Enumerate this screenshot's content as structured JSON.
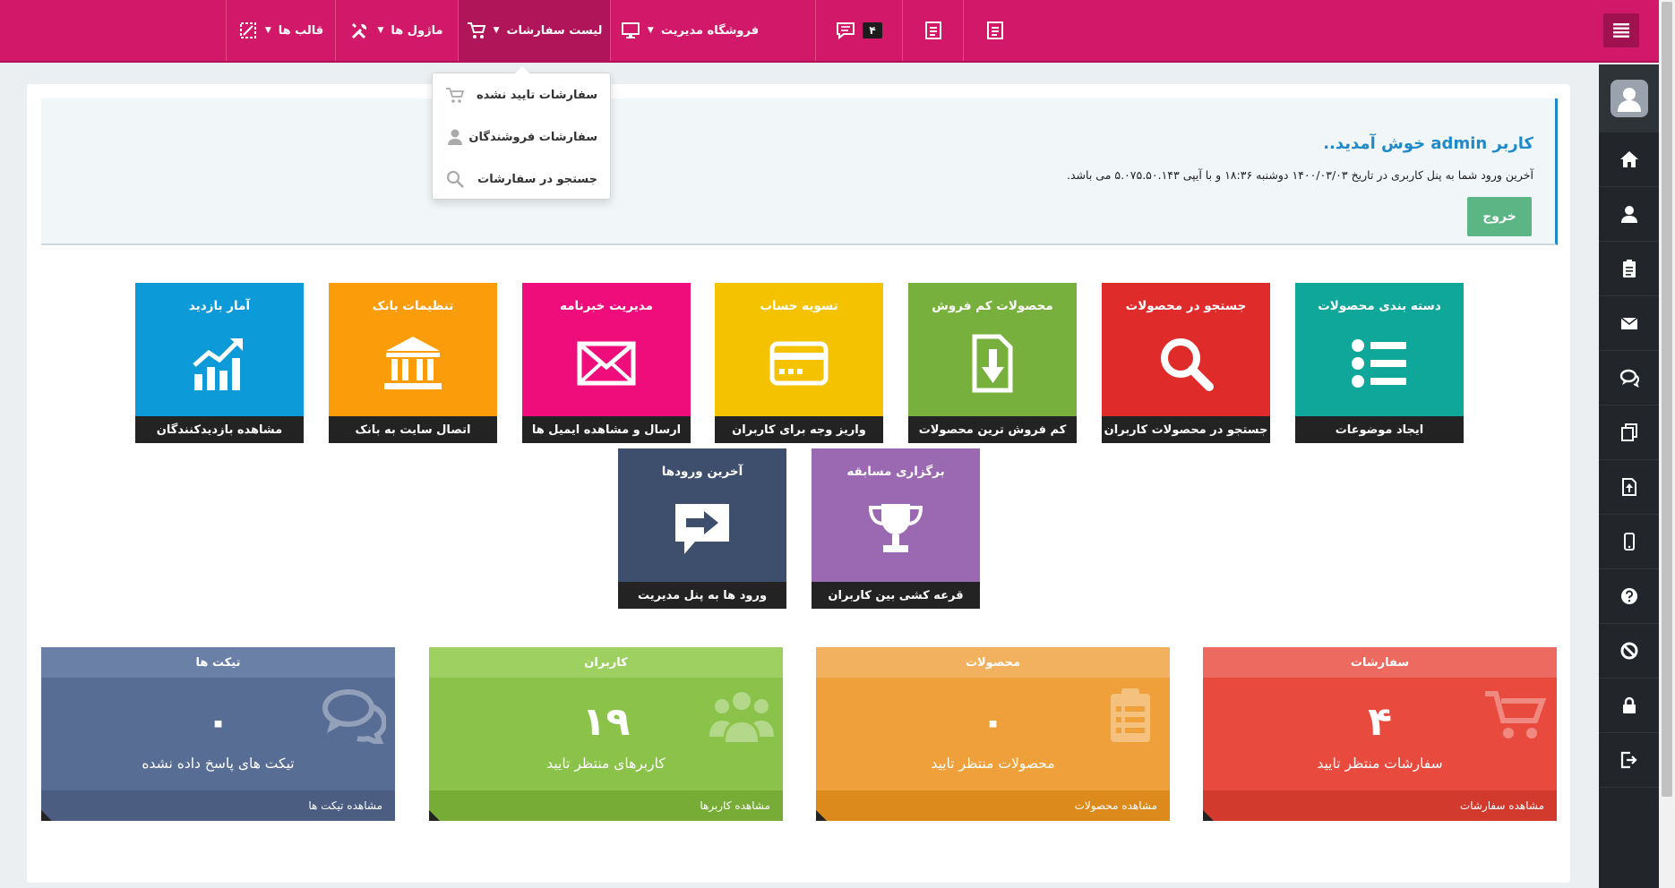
{
  "topbar": {
    "nav": [
      {
        "label": "فروشگاه مدیریت",
        "icon": "monitor-icon"
      },
      {
        "label": "لیست سفارشات",
        "icon": "cart-icon",
        "active": true
      },
      {
        "label": "ماژول ها",
        "icon": "tools-icon"
      },
      {
        "label": "قالب ها",
        "icon": "template-icon"
      }
    ],
    "message_count": "۴"
  },
  "dropdown": {
    "items": [
      {
        "label": "سفارشات تایید نشده",
        "icon": "cart-outline-icon"
      },
      {
        "label": "سفارشات فروشندگان",
        "icon": "user-icon"
      },
      {
        "label": "جستجو در سفارشات",
        "icon": "search-icon"
      }
    ]
  },
  "welcome": {
    "title": "کاربر admin خوش آمدید..",
    "text": "آخرین ورود شما به پنل کاربری در تاریخ ۱۴۰۰/۰۳/۰۳ دوشنبه ۱۸:۳۶ و با آیپی ۵.۰۷۵.۵۰.۱۴۳ می باشد.",
    "logout": "خروج"
  },
  "tiles": [
    {
      "title": "دسته بندی محصولات",
      "footer": "ایجاد موضوعات",
      "color": "#0fa79a",
      "icon": "list-icon"
    },
    {
      "title": "جستجو در محصولات",
      "footer": "جستجو در محصولات کاربران",
      "color": "#e02b2b",
      "icon": "search-icon"
    },
    {
      "title": "محصولات کم فروش",
      "footer": "کم فروش ترین محصولات",
      "color": "#77b03c",
      "icon": "download-doc-icon"
    },
    {
      "title": "تسویه حساب",
      "footer": "واریز وجه برای کاربران",
      "color": "#f5c200",
      "icon": "credit-card-icon"
    },
    {
      "title": "مدیریت خبرنامه",
      "footer": "ارسال و مشاهده ایمیل ها",
      "color": "#ee0d7b",
      "icon": "envelope-icon"
    },
    {
      "title": "تنظیمات بانک",
      "footer": "اتصال سایت به بانک",
      "color": "#fb9c0a",
      "icon": "bank-icon"
    },
    {
      "title": "آمار بازدید",
      "footer": "مشاهده بازدیدکنندگان",
      "color": "#0c9ad8",
      "icon": "chart-up-icon"
    },
    {
      "title": "برگزاری مسابقه",
      "footer": "قرعه کشی بین کاربران",
      "color": "#9b69b2",
      "icon": "trophy-icon"
    },
    {
      "title": "آخرین ورودها",
      "footer": "ورود ها به پنل مدیریت",
      "color": "#3e4f6e",
      "icon": "arrow-bubble-icon"
    }
  ],
  "stats": [
    {
      "title": "سفارشات",
      "value": "۴",
      "label": "سفارشات منتظر تایید",
      "footer": "مشاهده سفارشات",
      "color": "#e84b3e",
      "head": "#ec6a5f",
      "foot": "#d23a2e",
      "icon": "cart-icon"
    },
    {
      "title": "محصولات",
      "value": "۰",
      "label": "محصولات منتظر تایید",
      "footer": "مشاهده محصولات",
      "color": "#f0a03a",
      "head": "#f2b15e",
      "foot": "#dc8a1c",
      "icon": "clipboard-icon"
    },
    {
      "title": "کاربران",
      "value": "۱۹",
      "label": "کاربرهای منتظر تایید",
      "footer": "مشاهده کاربرها",
      "color": "#8bc34a",
      "head": "#9dd060",
      "foot": "#77ad36",
      "icon": "users-icon"
    },
    {
      "title": "تیکت ها",
      "value": "۰",
      "label": "تیکت های پاسخ داده نشده",
      "footer": "مشاهده تیکت ها",
      "color": "#586d94",
      "head": "#6b80a6",
      "foot": "#4b5e82",
      "icon": "chat-icon"
    }
  ]
}
